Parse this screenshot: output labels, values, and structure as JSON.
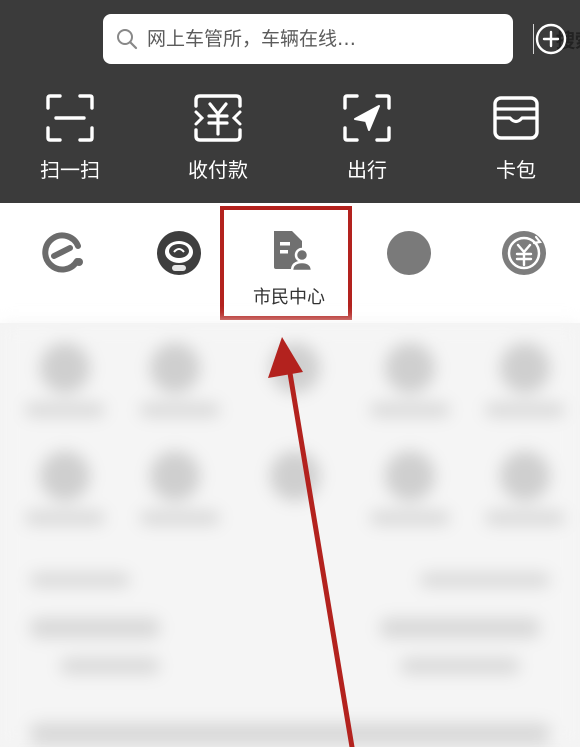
{
  "search": {
    "placeholder": "网上车管所，车辆在线…",
    "button_label": "搜索"
  },
  "quick_actions": [
    {
      "label": "扫一扫",
      "icon": "scan-icon"
    },
    {
      "label": "收付款",
      "icon": "payment-icon"
    },
    {
      "label": "出行",
      "icon": "travel-icon"
    },
    {
      "label": "卡包",
      "icon": "card-wallet-icon"
    }
  ],
  "apps": {
    "citizen_center_label": "市民中心",
    "icons": [
      "e-logo-icon",
      "robot-avatar-icon",
      "citizen-center-icon",
      "gray-circle-icon",
      "yuan-refresh-icon"
    ]
  },
  "colors": {
    "header_bg": "#3b3b3b",
    "annotation_red": "#b3221e"
  }
}
